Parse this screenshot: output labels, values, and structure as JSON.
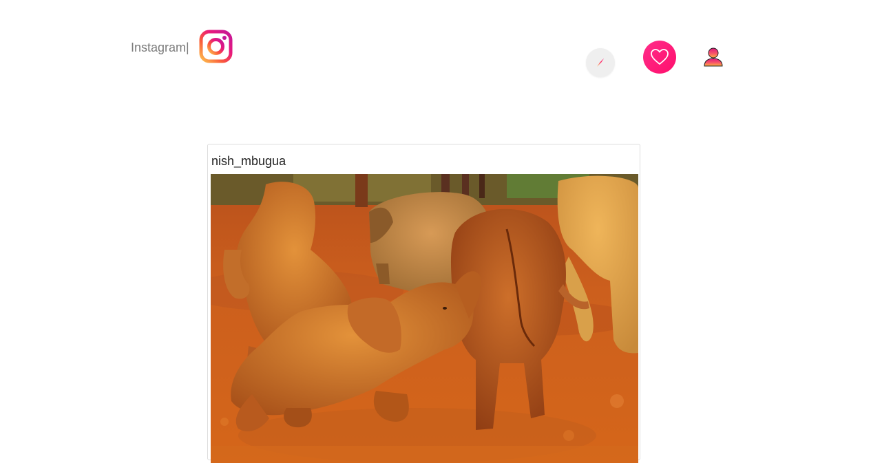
{
  "navbar": {
    "brand_text": "Instagram|",
    "brand_logo_icon": "instagram-logo-icon",
    "explore_icon": "compass-icon",
    "likes_icon": "heart-icon",
    "profile_icon": "user-icon",
    "colors": {
      "brand_text": "#7a7a7a",
      "likes_bg": "#ff1079",
      "explore_bg": "#efefef"
    }
  },
  "post": {
    "username": "nish_mbugua",
    "image_subject": "elephants-photo"
  }
}
